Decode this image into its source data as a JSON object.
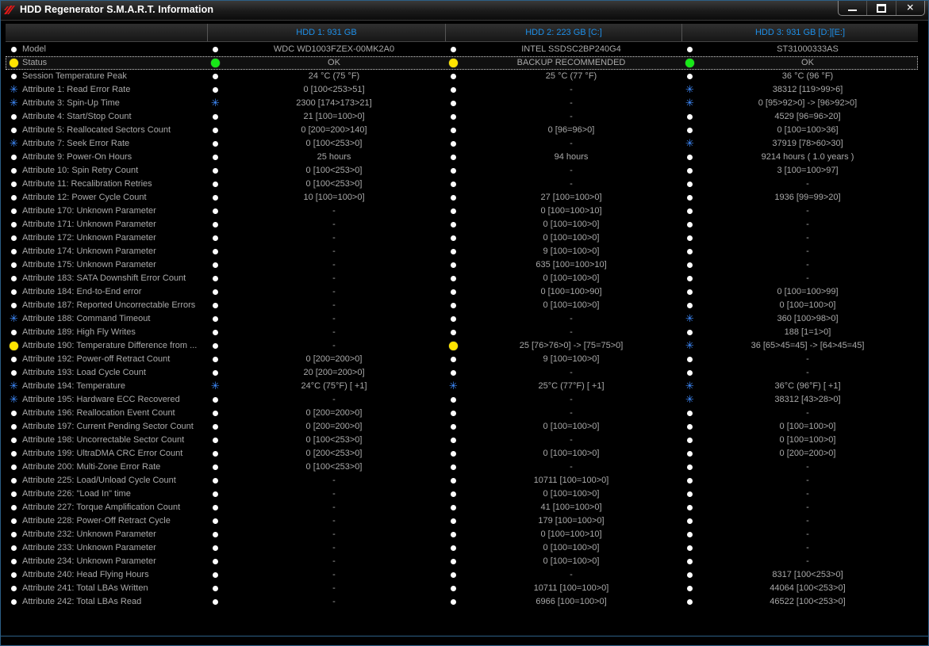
{
  "window": {
    "title": "HDD Regenerator S.M.A.R.T. Information"
  },
  "columns": [
    {
      "label": ""
    },
    {
      "label": "HDD 1: 931 GB"
    },
    {
      "label": "HDD 2: 223 GB [C:]"
    },
    {
      "label": "HDD 3: 931 GB [D:][E:]"
    }
  ],
  "rows": [
    {
      "label": "Model",
      "icon": "w",
      "cells": [
        [
          "w",
          "WDC WD1003FZEX-00MK2A0"
        ],
        [
          "w",
          "INTEL SSDSC2BP240G4"
        ],
        [
          "w",
          "ST31000333AS"
        ]
      ]
    },
    {
      "label": "Status",
      "icon": "y",
      "cells": [
        [
          "g",
          "OK"
        ],
        [
          "y",
          "BACKUP RECOMMENDED"
        ],
        [
          "g",
          "OK"
        ]
      ]
    },
    {
      "label": "Session Temperature Peak",
      "icon": "w",
      "cells": [
        [
          "w",
          "24 °C (75 °F)"
        ],
        [
          "w",
          "25 °C (77 °F)"
        ],
        [
          "w",
          "36 °C (96 °F)"
        ]
      ]
    },
    {
      "label": "Attribute 1: Read Error Rate",
      "icon": "s",
      "cells": [
        [
          "w",
          "0  [100<253>51]"
        ],
        [
          "w",
          "-"
        ],
        [
          "s",
          "38312  [119>99>6]"
        ]
      ]
    },
    {
      "label": "Attribute 3: Spin-Up Time",
      "icon": "s",
      "cells": [
        [
          "s",
          "2300  [174>173>21]"
        ],
        [
          "w",
          "-"
        ],
        [
          "s",
          "0  [95>92>0] -> [96>92>0]"
        ]
      ]
    },
    {
      "label": "Attribute 4: Start/Stop Count",
      "icon": "w",
      "cells": [
        [
          "w",
          "21  [100=100>0]"
        ],
        [
          "w",
          "-"
        ],
        [
          "w",
          "4529  [96=96>20]"
        ]
      ]
    },
    {
      "label": "Attribute 5: Reallocated Sectors Count",
      "icon": "w",
      "cells": [
        [
          "w",
          "0  [200=200>140]"
        ],
        [
          "w",
          "0  [96=96>0]"
        ],
        [
          "w",
          "0  [100=100>36]"
        ]
      ]
    },
    {
      "label": "Attribute 7: Seek Error Rate",
      "icon": "s",
      "cells": [
        [
          "w",
          "0  [100<253>0]"
        ],
        [
          "w",
          "-"
        ],
        [
          "s",
          "37919  [78>60>30]"
        ]
      ]
    },
    {
      "label": "Attribute 9: Power-On Hours",
      "icon": "w",
      "cells": [
        [
          "w",
          "25 hours"
        ],
        [
          "w",
          "94 hours"
        ],
        [
          "w",
          "9214 hours ( 1.0 years )"
        ]
      ]
    },
    {
      "label": "Attribute 10: Spin Retry Count",
      "icon": "w",
      "cells": [
        [
          "w",
          "0  [100<253>0]"
        ],
        [
          "w",
          "-"
        ],
        [
          "w",
          "3  [100=100>97]"
        ]
      ]
    },
    {
      "label": "Attribute 11: Recalibration Retries",
      "icon": "w",
      "cells": [
        [
          "w",
          "0  [100<253>0]"
        ],
        [
          "w",
          "-"
        ],
        [
          "w",
          "-"
        ]
      ]
    },
    {
      "label": "Attribute 12: Power Cycle Count",
      "icon": "w",
      "cells": [
        [
          "w",
          "10  [100=100>0]"
        ],
        [
          "w",
          "27  [100=100>0]"
        ],
        [
          "w",
          "1936  [99=99>20]"
        ]
      ]
    },
    {
      "label": "Attribute 170: Unknown Parameter",
      "icon": "w",
      "cells": [
        [
          "w",
          "-"
        ],
        [
          "w",
          "0  [100=100>10]"
        ],
        [
          "w",
          "-"
        ]
      ]
    },
    {
      "label": "Attribute 171: Unknown Parameter",
      "icon": "w",
      "cells": [
        [
          "w",
          "-"
        ],
        [
          "w",
          "0  [100=100>0]"
        ],
        [
          "w",
          "-"
        ]
      ]
    },
    {
      "label": "Attribute 172: Unknown Parameter",
      "icon": "w",
      "cells": [
        [
          "w",
          "-"
        ],
        [
          "w",
          "0  [100=100>0]"
        ],
        [
          "w",
          "-"
        ]
      ]
    },
    {
      "label": "Attribute 174: Unknown Parameter",
      "icon": "w",
      "cells": [
        [
          "w",
          "-"
        ],
        [
          "w",
          "9  [100=100>0]"
        ],
        [
          "w",
          "-"
        ]
      ]
    },
    {
      "label": "Attribute 175: Unknown Parameter",
      "icon": "w",
      "cells": [
        [
          "w",
          "-"
        ],
        [
          "w",
          "635  [100=100>10]"
        ],
        [
          "w",
          "-"
        ]
      ]
    },
    {
      "label": "Attribute 183: SATA Downshift Error Count",
      "icon": "w",
      "cells": [
        [
          "w",
          "-"
        ],
        [
          "w",
          "0  [100=100>0]"
        ],
        [
          "w",
          "-"
        ]
      ]
    },
    {
      "label": "Attribute 184: End-to-End error",
      "icon": "w",
      "cells": [
        [
          "w",
          "-"
        ],
        [
          "w",
          "0  [100=100>90]"
        ],
        [
          "w",
          "0  [100=100>99]"
        ]
      ]
    },
    {
      "label": "Attribute 187: Reported Uncorrectable Errors",
      "icon": "w",
      "cells": [
        [
          "w",
          "-"
        ],
        [
          "w",
          "0  [100=100>0]"
        ],
        [
          "w",
          "0  [100=100>0]"
        ]
      ]
    },
    {
      "label": "Attribute 188: Command Timeout",
      "icon": "s",
      "cells": [
        [
          "w",
          "-"
        ],
        [
          "w",
          "-"
        ],
        [
          "s",
          "360  [100>98>0]"
        ]
      ]
    },
    {
      "label": "Attribute 189: High Fly Writes",
      "icon": "w",
      "cells": [
        [
          "w",
          "-"
        ],
        [
          "w",
          "-"
        ],
        [
          "w",
          "188  [1=1>0]"
        ]
      ]
    },
    {
      "label": "Attribute 190: Temperature Difference from ...",
      "icon": "y",
      "cells": [
        [
          "w",
          "-"
        ],
        [
          "y",
          "25  [76>76>0] -> [75=75>0]"
        ],
        [
          "s",
          "36  [65>45=45] -> [64>45=45]"
        ]
      ]
    },
    {
      "label": "Attribute 192: Power-off Retract Count",
      "icon": "w",
      "cells": [
        [
          "w",
          "0  [200=200>0]"
        ],
        [
          "w",
          "9  [100=100>0]"
        ],
        [
          "w",
          "-"
        ]
      ]
    },
    {
      "label": "Attribute 193: Load Cycle Count",
      "icon": "w",
      "cells": [
        [
          "w",
          "20  [200=200>0]"
        ],
        [
          "w",
          "-"
        ],
        [
          "w",
          "-"
        ]
      ]
    },
    {
      "label": "Attribute 194: Temperature",
      "icon": "s",
      "cells": [
        [
          "s",
          "24°C (75°F)  [ +1]"
        ],
        [
          "s",
          "25°C (77°F)  [ +1]"
        ],
        [
          "s",
          "36°C (96°F)  [ +1]"
        ]
      ]
    },
    {
      "label": "Attribute 195: Hardware ECC Recovered",
      "icon": "s",
      "cells": [
        [
          "w",
          "-"
        ],
        [
          "w",
          "-"
        ],
        [
          "s",
          "38312  [43>28>0]"
        ]
      ]
    },
    {
      "label": "Attribute 196: Reallocation Event Count",
      "icon": "w",
      "cells": [
        [
          "w",
          "0  [200=200>0]"
        ],
        [
          "w",
          "-"
        ],
        [
          "w",
          "-"
        ]
      ]
    },
    {
      "label": "Attribute 197: Current Pending Sector Count",
      "icon": "w",
      "cells": [
        [
          "w",
          "0  [200=200>0]"
        ],
        [
          "w",
          "0  [100=100>0]"
        ],
        [
          "w",
          "0  [100=100>0]"
        ]
      ]
    },
    {
      "label": "Attribute 198: Uncorrectable Sector Count",
      "icon": "w",
      "cells": [
        [
          "w",
          "0  [100<253>0]"
        ],
        [
          "w",
          "-"
        ],
        [
          "w",
          "0  [100=100>0]"
        ]
      ]
    },
    {
      "label": "Attribute 199: UltraDMA CRC Error Count",
      "icon": "w",
      "cells": [
        [
          "w",
          "0  [200<253>0]"
        ],
        [
          "w",
          "0  [100=100>0]"
        ],
        [
          "w",
          "0  [200=200>0]"
        ]
      ]
    },
    {
      "label": "Attribute 200: Multi-Zone Error Rate",
      "icon": "w",
      "cells": [
        [
          "w",
          "0  [100<253>0]"
        ],
        [
          "w",
          "-"
        ],
        [
          "w",
          "-"
        ]
      ]
    },
    {
      "label": "Attribute 225: Load/Unload Cycle Count",
      "icon": "w",
      "cells": [
        [
          "w",
          "-"
        ],
        [
          "w",
          "10711  [100=100>0]"
        ],
        [
          "w",
          "-"
        ]
      ]
    },
    {
      "label": "Attribute 226: \"Load In\" time",
      "icon": "w",
      "cells": [
        [
          "w",
          "-"
        ],
        [
          "w",
          "0  [100=100>0]"
        ],
        [
          "w",
          "-"
        ]
      ]
    },
    {
      "label": "Attribute 227: Torque Amplification Count",
      "icon": "w",
      "cells": [
        [
          "w",
          "-"
        ],
        [
          "w",
          "41  [100=100>0]"
        ],
        [
          "w",
          "-"
        ]
      ]
    },
    {
      "label": "Attribute 228: Power-Off Retract Cycle",
      "icon": "w",
      "cells": [
        [
          "w",
          "-"
        ],
        [
          "w",
          "179  [100=100>0]"
        ],
        [
          "w",
          "-"
        ]
      ]
    },
    {
      "label": "Attribute 232: Unknown Parameter",
      "icon": "w",
      "cells": [
        [
          "w",
          "-"
        ],
        [
          "w",
          "0  [100=100>10]"
        ],
        [
          "w",
          "-"
        ]
      ]
    },
    {
      "label": "Attribute 233: Unknown Parameter",
      "icon": "w",
      "cells": [
        [
          "w",
          "-"
        ],
        [
          "w",
          "0  [100=100>0]"
        ],
        [
          "w",
          "-"
        ]
      ]
    },
    {
      "label": "Attribute 234: Unknown Parameter",
      "icon": "w",
      "cells": [
        [
          "w",
          "-"
        ],
        [
          "w",
          "0  [100=100>0]"
        ],
        [
          "w",
          "-"
        ]
      ]
    },
    {
      "label": "Attribute 240: Head Flying Hours",
      "icon": "w",
      "cells": [
        [
          "w",
          "-"
        ],
        [
          "w",
          "-"
        ],
        [
          "w",
          "8317  [100<253>0]"
        ]
      ]
    },
    {
      "label": "Attribute 241: Total LBAs Written",
      "icon": "w",
      "cells": [
        [
          "w",
          "-"
        ],
        [
          "w",
          "10711  [100=100>0]"
        ],
        [
          "w",
          "44064  [100<253>0]"
        ]
      ]
    },
    {
      "label": "Attribute 242: Total LBAs Read",
      "icon": "w",
      "cells": [
        [
          "w",
          "-"
        ],
        [
          "w",
          "6966  [100=100>0]"
        ],
        [
          "w",
          "46522  [100<253>0]"
        ]
      ]
    }
  ]
}
